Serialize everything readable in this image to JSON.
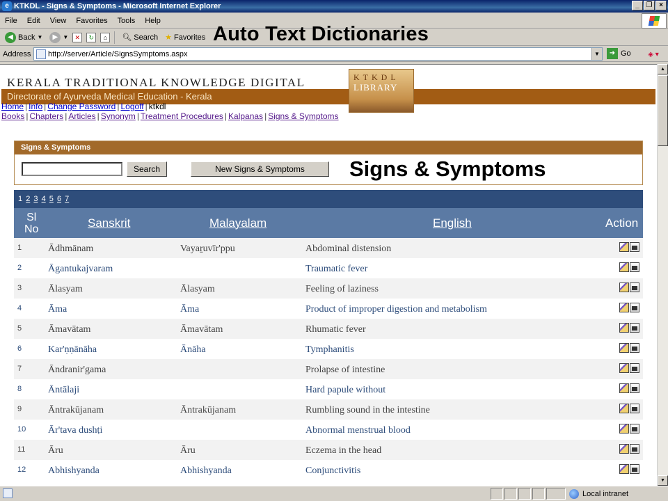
{
  "window": {
    "title": "KTKDL - Signs & Symptoms - Microsoft Internet Explorer",
    "controls": [
      "_",
      "❐",
      "×"
    ]
  },
  "menu": [
    "File",
    "Edit",
    "View",
    "Favorites",
    "Tools",
    "Help"
  ],
  "toolbar": {
    "back": "Back",
    "search": "Search",
    "favorites": "Favorites"
  },
  "overlay_title": "Auto Text Dictionaries",
  "address": {
    "label": "Address",
    "url": "http://server/Article/SignsSymptoms.aspx",
    "go": "Go"
  },
  "banner": {
    "title": "KERALA TRADITIONAL KNOWLEDGE DIGITAL",
    "subtitle": "Directorate of Ayurveda Medical Education - Kerala",
    "logo_line1": "KTKDL",
    "logo_line2": "LIBRARY"
  },
  "nav1": {
    "links": [
      "Home",
      "Info",
      "Change Password",
      "Logoff"
    ],
    "user": "ktkdl"
  },
  "nav2": {
    "links": [
      "Books",
      "Chapters",
      "Articles",
      "Synonym",
      "Treatment Procedures",
      "Kalpanas",
      "Signs & Symptoms"
    ]
  },
  "panel": {
    "header": "Signs & Symptoms",
    "search_value": "",
    "search_button": "Search",
    "new_button": "New Signs & Symptoms"
  },
  "overlay_heading": "Signs & Symptoms",
  "table": {
    "pages": [
      "1",
      "2",
      "3",
      "4",
      "5",
      "6",
      "7"
    ],
    "current_page": "1",
    "headers": {
      "sl_line1": "Sl",
      "sl_line2": "No",
      "sanskrit": "Sanskrit",
      "malayalam": "Malayalam",
      "english": "English",
      "action": "Action"
    },
    "rows": [
      {
        "sl": "1",
        "sanskrit": "Ādhmānam",
        "malayalam": "Vayaṟuvīr'ppu",
        "english": "Abdominal distension"
      },
      {
        "sl": "2",
        "sanskrit": "Āgantukajvaram",
        "malayalam": "",
        "english": "Traumatic fever"
      },
      {
        "sl": "3",
        "sanskrit": "Ālasyam",
        "malayalam": "Ālasyam",
        "english": "Feeling of laziness"
      },
      {
        "sl": "4",
        "sanskrit": "Āma",
        "malayalam": "Āma",
        "english": "Product of improper digestion and metabolism"
      },
      {
        "sl": "5",
        "sanskrit": "Āmavātam",
        "malayalam": "Āmavātam",
        "english": "Rhumatic fever"
      },
      {
        "sl": "6",
        "sanskrit": "Kar'ṇṇānāha",
        "malayalam": "Ānāha",
        "english": "Tymphanitis"
      },
      {
        "sl": "7",
        "sanskrit": "Āndranir'gama",
        "malayalam": "",
        "english": "Prolapse of intestine"
      },
      {
        "sl": "8",
        "sanskrit": "Āntālaji",
        "malayalam": "",
        "english": "Hard papule without"
      },
      {
        "sl": "9",
        "sanskrit": "Āntrakūjanam",
        "malayalam": "Āntrakūjanam",
        "english": "Rumbling sound in the intestine"
      },
      {
        "sl": "10",
        "sanskrit": "Ār'tava dushṭi",
        "malayalam": "",
        "english": "Abnormal menstrual blood"
      },
      {
        "sl": "11",
        "sanskrit": "Āru",
        "malayalam": "Āru",
        "english": "Eczema in the head"
      },
      {
        "sl": "12",
        "sanskrit": "Abhishyanda",
        "malayalam": "Abhishyanda",
        "english": "Conjunctivitis"
      }
    ]
  },
  "status": {
    "zone": "Local intranet"
  },
  "colors": {
    "banner_strip": "#a25c14",
    "table_header": "#5b7aa4",
    "pager_bar": "#2e4d7b"
  }
}
